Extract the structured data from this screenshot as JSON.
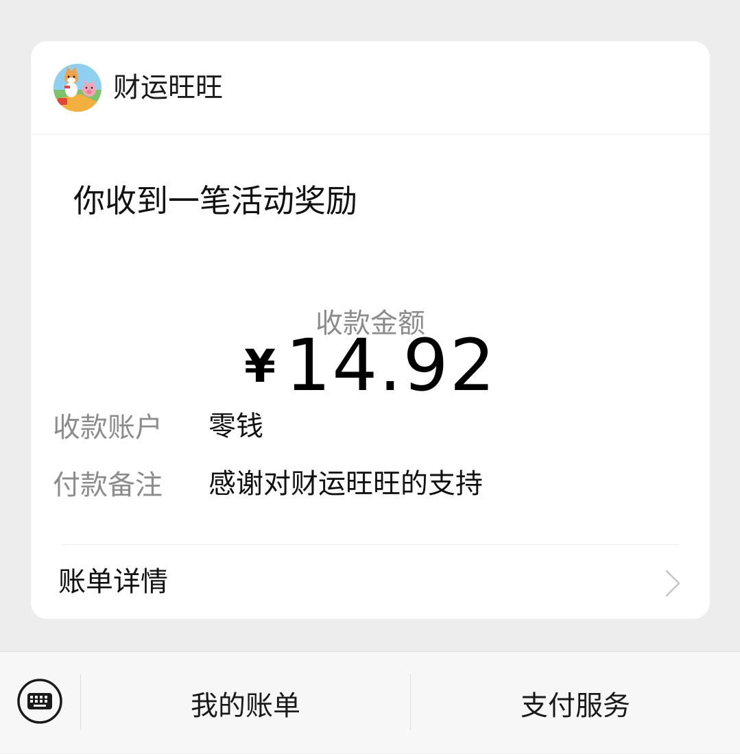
{
  "header": {
    "app_name": "财运旺旺",
    "app_icon": "shiba-dog-pig-mascot-icon"
  },
  "notice": {
    "headline": "你收到一笔活动奖励",
    "amount_label": "收款金额",
    "currency_symbol": "¥",
    "amount_value": "14.92"
  },
  "details": [
    {
      "label": "收款账户",
      "value": "零钱"
    },
    {
      "label": "付款备注",
      "value": "感谢对财运旺旺的支持"
    }
  ],
  "bill_detail": {
    "label": "账单详情",
    "icon": "chevron-right-icon"
  },
  "bottom_bar": {
    "keyboard_icon": "keyboard-icon",
    "tabs": [
      {
        "label": "我的账单"
      },
      {
        "label": "支付服务"
      }
    ]
  }
}
